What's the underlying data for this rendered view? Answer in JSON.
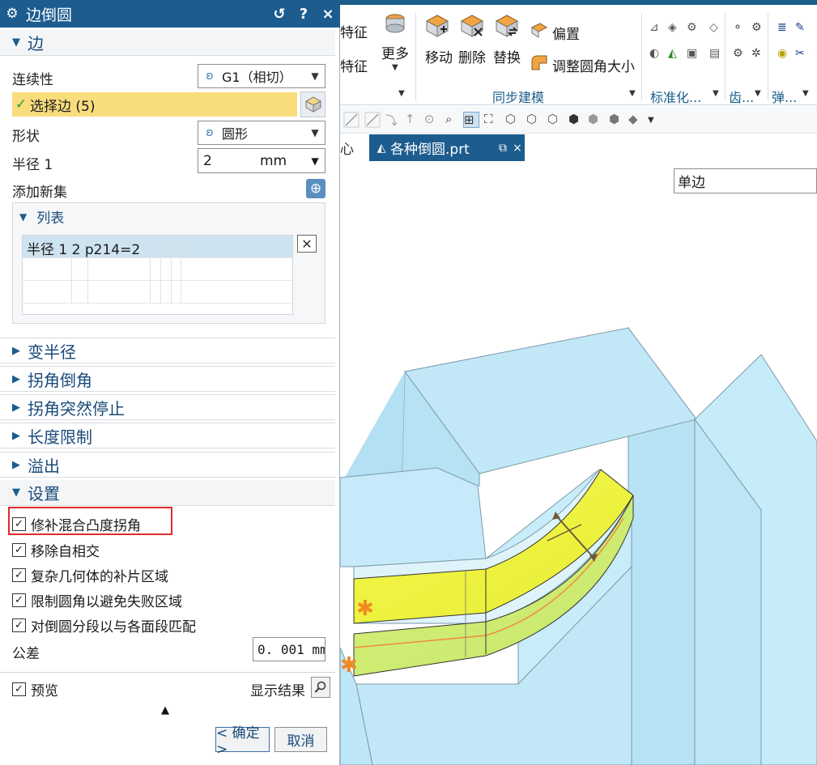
{
  "dialog": {
    "title": "边倒圆",
    "reset_btn": "↺",
    "help_btn": "?",
    "close_btn": "×",
    "edge_section": "边",
    "continuity_label": "连续性",
    "continuity_value": "G1（相切）",
    "select_edge": "选择边 (5)",
    "shape_label": "形状",
    "shape_value": "圆形",
    "radius_label": "半径 1",
    "radius_value": "2",
    "radius_unit": "mm",
    "add_set_label": "添加新集",
    "list_header": "列表",
    "list_row": "半径 1  2  p214=2",
    "sections_collapsed": [
      "变半径",
      "拐角倒角",
      "拐角突然停止",
      "长度限制",
      "溢出"
    ],
    "settings_section": "设置",
    "settings_checks": [
      "修补混合凸度拐角",
      "移除自相交",
      "复杂几何体的补片区域",
      "限制圆角以避免失败区域",
      "对倒圆分段以与各面段匹配"
    ],
    "tolerance_label": "公差",
    "tolerance_value": "0. 001 mm",
    "preview_label": "预览",
    "show_result_label": "显示结果",
    "ok_label": "< 确定 >",
    "cancel_label": "取消"
  },
  "ribbon": {
    "feat1": "特征",
    "feat2": "特征",
    "more": "更多",
    "move": "移动",
    "delete": "删除",
    "replace": "替换",
    "offset": "偏置",
    "resize_blend": "调整圆角大小",
    "group_sync": "同步建模",
    "group_std": "标准化...",
    "group_gear": "齿...",
    "group_spring": "弹..."
  },
  "tabs": {
    "prev_tab": "心",
    "active_tab": "各种倒圆.prt"
  },
  "filter": {
    "value": "单边"
  },
  "colors": {
    "title_bar": "#1c5c8e",
    "highlight": "#f9dc7c",
    "red_box": "#e02a2a",
    "model_blue": "#bfe6f7",
    "blend_yellow": "#f0f23a"
  }
}
